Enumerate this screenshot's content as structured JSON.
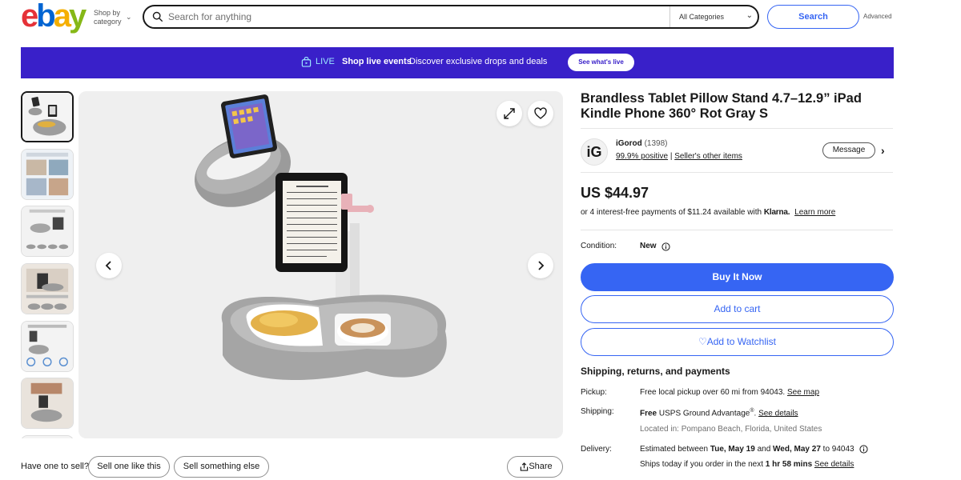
{
  "header": {
    "logo": {
      "e": "e",
      "b": "b",
      "a": "a",
      "y": "y"
    },
    "shop_by_1": "Shop by",
    "shop_by_2": "category",
    "search_placeholder": "Search for anything",
    "category": "All Categories",
    "search_button": "Search",
    "advanced": "Advanced"
  },
  "banner": {
    "live": "LIVE",
    "events": "Shop live events",
    "description": "Discover exclusive drops and deals",
    "button": "See what's live",
    "color": "#3920c9"
  },
  "product": {
    "title": "Brandless Tablet Pillow Stand 4.7–12.9” iPad Kindle Phone 360° Rot Gray S",
    "seller": {
      "avatar": "iG",
      "name": "iGorod",
      "feedback_count": "(1398)",
      "positive": "99.9% positive",
      "other_items": "Seller's other items",
      "message": "Message"
    },
    "price": "US $44.97",
    "klarna": {
      "text": "or 4 interest-free payments of $11.24 available with",
      "brand": "Klarna.",
      "link": "Learn more"
    },
    "condition_label": "Condition:",
    "condition_value": "New",
    "buy_now": "Buy It Now",
    "add_to_cart": "Add to cart",
    "watchlist": "Add to Watchlist"
  },
  "shipping": {
    "heading": "Shipping, returns, and payments",
    "pickup_label": "Pickup:",
    "pickup_text": "Free local pickup over 60 mi from 94043.",
    "pickup_link": "See map",
    "shipping_label": "Shipping:",
    "shipping_free": "Free",
    "shipping_service": "USPS Ground Advantage",
    "shipping_reg": "®",
    "shipping_link": "See details",
    "location": "Located in: Pompano Beach, Florida, United States",
    "delivery_label": "Delivery:",
    "delivery_pre": "Estimated between",
    "delivery_d1": "Tue, May 19",
    "delivery_and": "and",
    "delivery_d2": "Wed, May 27",
    "delivery_to": "to 94043",
    "ships_pre": "Ships today if you order in the next",
    "ships_time": "1 hr 58 mins",
    "ships_link": "See details"
  },
  "footer": {
    "have_one": "Have one to sell?",
    "sell_like": "Sell one like this",
    "sell_else": "Sell something else",
    "share": "Share"
  },
  "colors": {
    "accent": "#3665f3",
    "text": "#191919"
  }
}
